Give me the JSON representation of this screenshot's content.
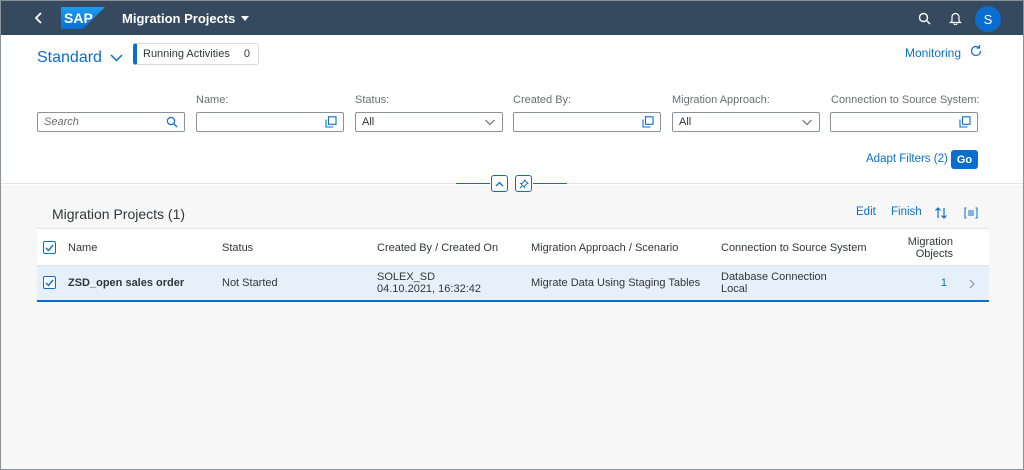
{
  "shell": {
    "title": "Migration Projects",
    "avatar_initial": "S",
    "logo_text": "SAP",
    "icons": [
      "back-icon",
      "search-icon",
      "bell-icon"
    ]
  },
  "header": {
    "variant": "Standard",
    "running_label": "Running Activities",
    "running_count": "0",
    "monitoring": "Monitoring"
  },
  "filters": {
    "search_placeholder": "Search",
    "name_label": "Name:",
    "status_label": "Status:",
    "status_value": "All",
    "created_by_label": "Created By:",
    "approach_label": "Migration Approach:",
    "approach_value": "All",
    "connection_label": "Connection to Source System:",
    "adapt": "Adapt Filters (2)",
    "go": "Go"
  },
  "table": {
    "title": "Migration Projects (1)",
    "edit": "Edit",
    "finish": "Finish",
    "columns": {
      "name": "Name",
      "status": "Status",
      "created": "Created By / Created On",
      "approach": "Migration Approach / Scenario",
      "connection": "Connection to Source System",
      "objects_1": "Migration",
      "objects_2": "Objects"
    },
    "rows": [
      {
        "name": "ZSD_open sales order",
        "status": "Not Started",
        "created_by": "SOLEX_SD",
        "created_on": "04.10.2021, 16:32:42",
        "approach": "Migrate Data Using Staging Tables",
        "connection_1": "Database Connection",
        "connection_2": "Local",
        "objects": "1"
      }
    ]
  },
  "colors": {
    "shell": "#354a5f",
    "accent": "#0a6ed1",
    "row_selected": "#e5f0fa"
  }
}
